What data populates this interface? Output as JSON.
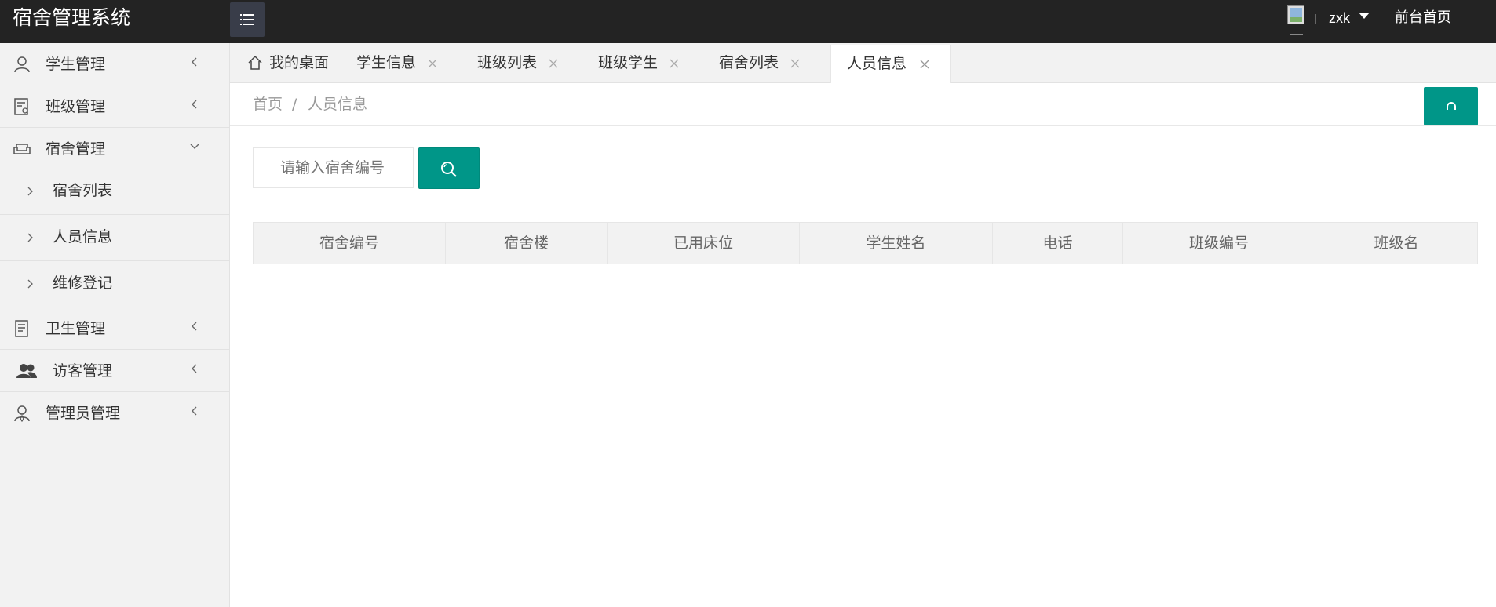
{
  "app": {
    "title": "宿舍管理系统"
  },
  "header": {
    "username": "zxk",
    "front_link": "前台首页"
  },
  "sidebar": {
    "items": [
      {
        "label": "学生管理",
        "icon": "user-icon",
        "expanded": false
      },
      {
        "label": "班级管理",
        "icon": "class-icon",
        "expanded": false
      },
      {
        "label": "宿舍管理",
        "icon": "sofa-icon",
        "expanded": true,
        "children": [
          {
            "label": "宿舍列表"
          },
          {
            "label": "人员信息"
          },
          {
            "label": "维修登记"
          }
        ]
      },
      {
        "label": "卫生管理",
        "icon": "clipboard-icon",
        "expanded": false
      },
      {
        "label": "访客管理",
        "icon": "users-icon",
        "expanded": false
      },
      {
        "label": "管理员管理",
        "icon": "admin-icon",
        "expanded": false
      }
    ]
  },
  "tabs": [
    {
      "label": "我的桌面",
      "closable": false,
      "active": false
    },
    {
      "label": "学生信息",
      "closable": true,
      "active": false
    },
    {
      "label": "班级列表",
      "closable": true,
      "active": false
    },
    {
      "label": "班级学生",
      "closable": true,
      "active": false
    },
    {
      "label": "宿舍列表",
      "closable": true,
      "active": false
    },
    {
      "label": "人员信息",
      "closable": true,
      "active": true
    }
  ],
  "breadcrumb": {
    "home": "首页",
    "separator": "/",
    "current": "人员信息"
  },
  "search": {
    "placeholder": "请输入宿舍编号",
    "value": ""
  },
  "table": {
    "columns": [
      "宿舍编号",
      "宿舍楼",
      "已用床位",
      "学生姓名",
      "电话",
      "班级编号",
      "班级名"
    ],
    "rows": []
  },
  "colors": {
    "header_bg": "#232323",
    "accent": "#009688",
    "sidebar_bg": "#f2f2f2"
  }
}
